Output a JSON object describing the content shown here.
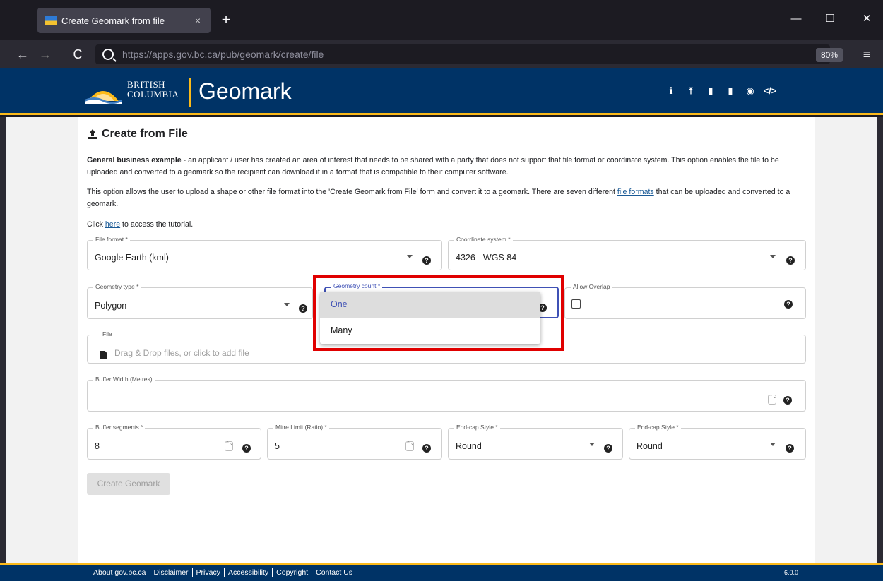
{
  "browser": {
    "tab_title": "Create Geomark from file",
    "tab_close": "×",
    "new_tab": "+",
    "url_display": "https://apps.gov.bc.ca/pub/geomark/create/file",
    "zoom": "80%",
    "window_minimize": "—",
    "window_maximize": "☐",
    "window_close": "✕",
    "back": "←",
    "forward": "→",
    "reload": "C",
    "menu": "≡"
  },
  "header": {
    "logo_line1": "BRITISH",
    "logo_line2": "COLUMBIA",
    "app_title": "Geomark",
    "icons": [
      "info-icon",
      "upload-icon",
      "clipboard-icon",
      "copy-icon",
      "globe-icon",
      "code-icon"
    ],
    "icon_glyphs": [
      "ℹ",
      "⤒",
      "▮",
      "▮",
      "◉",
      "</>"
    ]
  },
  "page": {
    "title": "Create from File",
    "para1_bold": "General business example",
    "para1_rest": " - an applicant / user has created an area of interest that needs to be shared with a party that does not support that file format or coordinate system. This option enables the file to be uploaded and converted to a geomark so the recipient can download it in a format that is compatible to their computer software.",
    "para2_before": "This option allows the user to upload a shape or other file format into the 'Create Geomark from File' form and convert it to a geomark. There are seven different ",
    "para2_link": "file formats",
    "para2_after": " that can be uploaded and converted to a geomark.",
    "para3_before": "Click ",
    "para3_link": "here",
    "para3_after": " to access the tutorial."
  },
  "form": {
    "file_format": {
      "label": "File format *",
      "value": "Google Earth (kml)"
    },
    "coordinate_system": {
      "label": "Coordinate system *",
      "value": "4326 - WGS 84"
    },
    "geometry_type": {
      "label": "Geometry type *",
      "value": "Polygon"
    },
    "geometry_count": {
      "label": "Geometry count *",
      "options": [
        "One",
        "Many"
      ],
      "selected": "One"
    },
    "allow_overlap": {
      "label": "Allow Overlap",
      "checked": false
    },
    "file": {
      "label": "File",
      "placeholder": "Drag & Drop files, or click to add file"
    },
    "buffer_width": {
      "label": "Buffer Width (Metres)",
      "value": ""
    },
    "buffer_segments": {
      "label": "Buffer segments *",
      "value": "8"
    },
    "mitre_limit": {
      "label": "Mitre Limit (Ratio) *",
      "value": "5"
    },
    "end_cap_style_1": {
      "label": "End-cap Style *",
      "value": "Round"
    },
    "end_cap_style_2": {
      "label": "End-cap Style *",
      "value": "Round"
    },
    "help_glyph": "?",
    "spin_glyph": "⌃⌄",
    "create_button": "Create Geomark"
  },
  "footer": {
    "links": [
      "About gov.bc.ca",
      "Disclaimer",
      "Privacy",
      "Accessibility",
      "Copyright",
      "Contact Us"
    ],
    "version": "6.0.0"
  },
  "colors": {
    "bc_blue": "#003366",
    "bc_gold": "#fcba19",
    "focus_indigo": "#3f51b5",
    "annotation_red": "#e00000"
  }
}
